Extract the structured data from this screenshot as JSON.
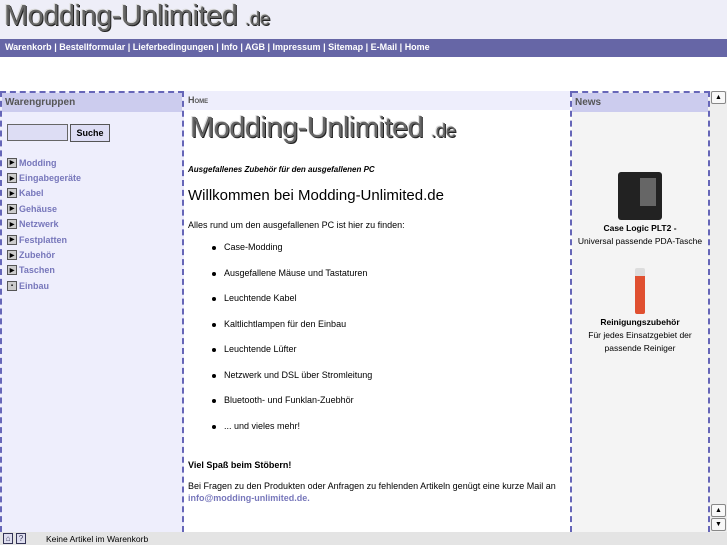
{
  "header": {
    "logo_main": "Modding-Unlimited",
    "logo_tld": ".de"
  },
  "nav": [
    "Warenkorb",
    "Bestellformular",
    "Lieferbedingungen",
    "Info",
    "AGB",
    "Impressum",
    "Sitemap",
    "E-Mail",
    "Home"
  ],
  "left": {
    "title": "Warengruppen",
    "search_button": "Suche",
    "search_value": "",
    "categories": [
      "Modding",
      "Eingabegeräte",
      "Kabel",
      "Gehäuse",
      "Netzwerk",
      "Festplatten",
      "Zubehör",
      "Taschen",
      "Einbau"
    ]
  },
  "center": {
    "breadcrumb": "Home",
    "slogan": "Ausgefallenes Zubehör für den ausgefallenen PC",
    "heading": "Willkommen bei Modding-Unlimited.de",
    "intro": "Alles rund um den ausgefallenen PC ist hier zu finden:",
    "features": [
      "Case-Modding",
      "Ausgefallene Mäuse und Tastaturen",
      "Leuchtende Kabel",
      "Kaltlichtlampen für den Einbau",
      "Leuchtende Lüfter",
      "Netzwerk und DSL über Stromleitung",
      "Bluetooth- und Funklan-Zuebhör",
      "... und vieles mehr!"
    ],
    "fun": "Viel Spaß beim Stöbern!",
    "ask": "Bei Fragen zu den Produkten oder Anfragen zu fehlenden Artikeln genügt eine kurze Mail an",
    "email": "info@modding-unlimited.de."
  },
  "right": {
    "title": "News",
    "items": [
      {
        "name": "Case Logic PLT2 -",
        "desc": "Universal passende PDA-Tasche"
      },
      {
        "name": "Reinigungszubehör",
        "desc": "Für jedes Einsatzgebiet der passende Reiniger"
      }
    ]
  },
  "status": {
    "text": "Keine Artikel im Warenkorb"
  }
}
